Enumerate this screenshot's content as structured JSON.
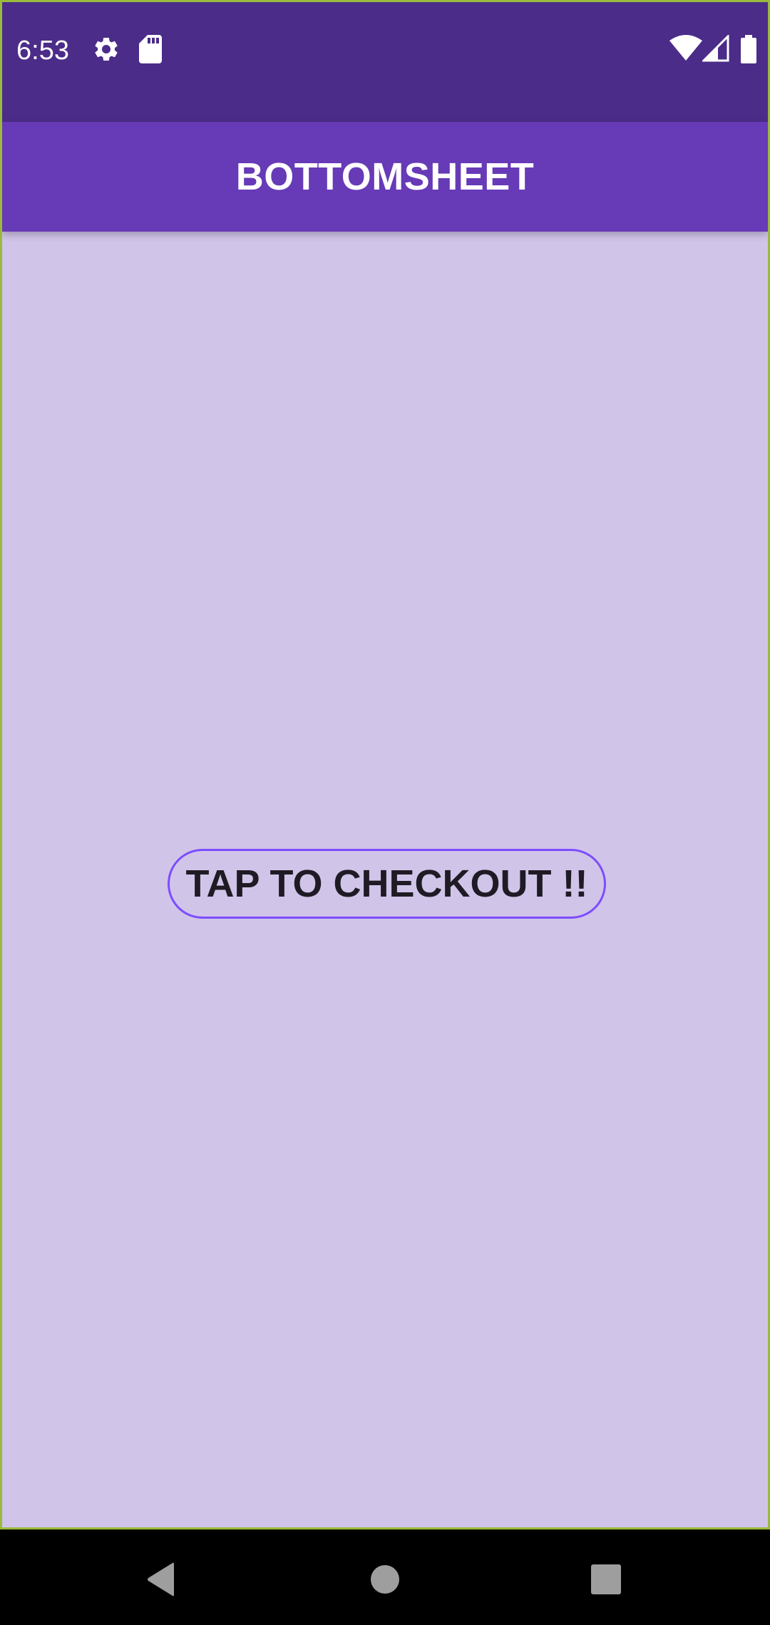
{
  "status_bar": {
    "time": "6:53",
    "left_icons": [
      "gear-icon",
      "sd-card-icon"
    ],
    "right_icons": [
      "wifi-icon",
      "signal-icon",
      "battery-icon"
    ]
  },
  "app_bar": {
    "title": "BOTTOMSHEET"
  },
  "main": {
    "checkout_button_label": "TAP TO CHECKOUT !!"
  },
  "nav_bar": {
    "buttons": [
      "back-icon",
      "home-icon",
      "recents-icon"
    ]
  },
  "colors": {
    "status_bar": "#4b2c89",
    "app_bar": "#673ab7",
    "background": "#d1c4e9",
    "button_border": "#7c4dff",
    "button_text": "#1f1b24"
  }
}
